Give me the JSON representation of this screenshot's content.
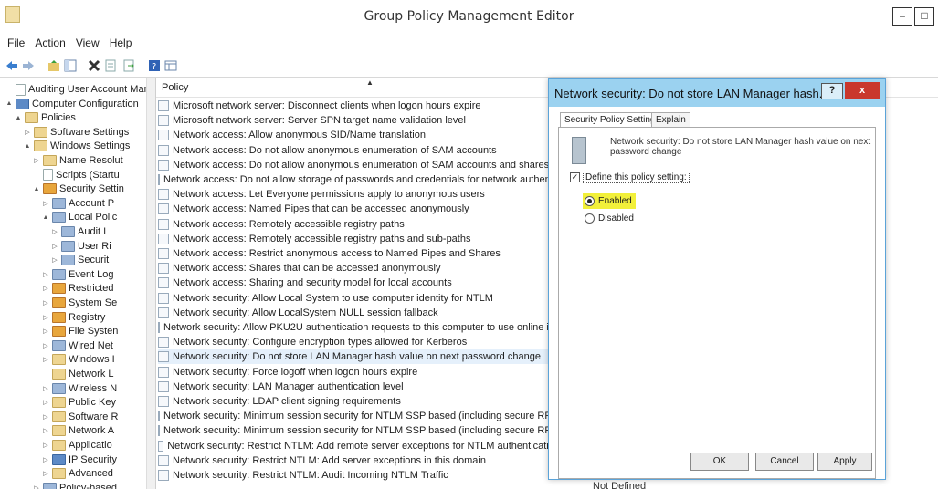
{
  "window": {
    "title": "Group Policy Management Editor",
    "minimize_label": "–",
    "maximize_label": "□"
  },
  "menu": [
    "File",
    "Action",
    "View",
    "Help"
  ],
  "tree": [
    {
      "label": "Auditing User Account Man",
      "level": 0,
      "toggle": "",
      "icon": "doc"
    },
    {
      "label": "Computer Configuration",
      "level": 0,
      "toggle": "▲",
      "icon": "comp"
    },
    {
      "label": "Policies",
      "level": 1,
      "toggle": "▲",
      "icon": "folder"
    },
    {
      "label": "Software Settings",
      "level": 2,
      "toggle": "▷",
      "icon": "folder"
    },
    {
      "label": "Windows Settings",
      "level": 2,
      "toggle": "▲",
      "icon": "folder"
    },
    {
      "label": "Name Resolut",
      "level": 3,
      "toggle": "▷",
      "icon": "folder"
    },
    {
      "label": "Scripts (Startu",
      "level": 3,
      "toggle": "",
      "icon": "doc"
    },
    {
      "label": "Security Settin",
      "level": 3,
      "toggle": "▲",
      "icon": "shield"
    },
    {
      "label": "Account P",
      "level": 4,
      "toggle": "▷",
      "icon": "pol"
    },
    {
      "label": "Local Polic",
      "level": 4,
      "toggle": "▲",
      "icon": "pol"
    },
    {
      "label": "Audit I",
      "level": 5,
      "toggle": "▷",
      "icon": "pol"
    },
    {
      "label": "User Ri",
      "level": 5,
      "toggle": "▷",
      "icon": "pol"
    },
    {
      "label": "Securit",
      "level": 5,
      "toggle": "▷",
      "icon": "pol"
    },
    {
      "label": "Event Log",
      "level": 4,
      "toggle": "▷",
      "icon": "pol"
    },
    {
      "label": "Restricted",
      "level": 4,
      "toggle": "▷",
      "icon": "shield"
    },
    {
      "label": "System Se",
      "level": 4,
      "toggle": "▷",
      "icon": "shield"
    },
    {
      "label": "Registry",
      "level": 4,
      "toggle": "▷",
      "icon": "shield"
    },
    {
      "label": "File Systen",
      "level": 4,
      "toggle": "▷",
      "icon": "shield"
    },
    {
      "label": "Wired Net",
      "level": 4,
      "toggle": "▷",
      "icon": "pol"
    },
    {
      "label": "Windows I",
      "level": 4,
      "toggle": "▷",
      "icon": "folder"
    },
    {
      "label": "Network L",
      "level": 4,
      "toggle": "",
      "icon": "folder"
    },
    {
      "label": "Wireless N",
      "level": 4,
      "toggle": "▷",
      "icon": "pol"
    },
    {
      "label": "Public Key",
      "level": 4,
      "toggle": "▷",
      "icon": "folder"
    },
    {
      "label": "Software R",
      "level": 4,
      "toggle": "▷",
      "icon": "folder"
    },
    {
      "label": "Network A",
      "level": 4,
      "toggle": "▷",
      "icon": "folder"
    },
    {
      "label": "Applicatio",
      "level": 4,
      "toggle": "▷",
      "icon": "folder"
    },
    {
      "label": "IP Security",
      "level": 4,
      "toggle": "▷",
      "icon": "comp"
    },
    {
      "label": "Advanced",
      "level": 4,
      "toggle": "▷",
      "icon": "folder"
    },
    {
      "label": "Policy-based",
      "level": 3,
      "toggle": "▷",
      "icon": "pol"
    }
  ],
  "list": {
    "column_policy": "Policy",
    "rows": [
      "Microsoft network server: Disconnect clients when logon hours expire",
      "Microsoft network server: Server SPN target name validation level",
      "Network access: Allow anonymous SID/Name translation",
      "Network access: Do not allow anonymous enumeration of SAM accounts",
      "Network access: Do not allow anonymous enumeration of SAM accounts and shares",
      "Network access: Do not allow storage of passwords and credentials for network authentica",
      "Network access: Let Everyone permissions apply to anonymous users",
      "Network access: Named Pipes that can be accessed anonymously",
      "Network access: Remotely accessible registry paths",
      "Network access: Remotely accessible registry paths and sub-paths",
      "Network access: Restrict anonymous access to Named Pipes and Shares",
      "Network access: Shares that can be accessed anonymously",
      "Network access: Sharing and security model for local accounts",
      "Network security: Allow Local System to use computer identity for NTLM",
      "Network security: Allow LocalSystem NULL session fallback",
      "Network security: Allow PKU2U authentication requests to this computer to use online ide",
      "Network security: Configure encryption types allowed for Kerberos",
      "Network security: Do not store LAN Manager hash value on next password change",
      "Network security: Force logoff when logon hours expire",
      "Network security: LAN Manager authentication level",
      "Network security: LDAP client signing requirements",
      "Network security: Minimum session security for NTLM SSP based (including secure RPC) c",
      "Network security: Minimum session security for NTLM SSP based (including secure RPC) s",
      "Network security: Restrict NTLM: Add remote server exceptions for NTLM authentication",
      "Network security: Restrict NTLM: Add server exceptions in this domain",
      "Network security: Restrict NTLM: Audit Incoming NTLM Traffic"
    ],
    "selected_index": 17,
    "last_setting_value": "Not Defined"
  },
  "dialog": {
    "title": "Network security: Do not store LAN Manager hash...",
    "help_label": "?",
    "close_label": "x",
    "tabs": [
      "Security Policy Setting",
      "Explain"
    ],
    "description": "Network security: Do not store LAN Manager hash value on next password change",
    "define_label": "Define this policy setting:",
    "define_checked": true,
    "options": [
      {
        "label": "Enabled",
        "selected": true
      },
      {
        "label": "Disabled",
        "selected": false
      }
    ],
    "buttons": {
      "ok": "OK",
      "cancel": "Cancel",
      "apply": "Apply"
    }
  },
  "colors": {
    "dialog_title": "#9bd2f0",
    "dialog_border": "#5ba3d8",
    "highlight": "#f2f03a",
    "close": "#c9372c",
    "selection": "#e5f0fb"
  }
}
